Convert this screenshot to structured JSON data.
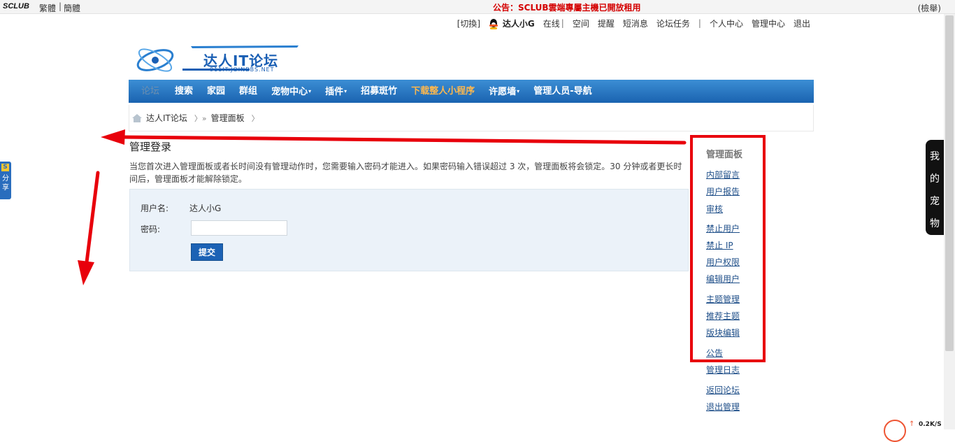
{
  "topbar": {
    "brand": "SCLUB",
    "lang_traditional": "繁體",
    "lang_separator": "|",
    "lang_simplified": "簡體",
    "announcement": "公告：SCLUB雲端專屬主機已開放租用",
    "login": "(檢舉)"
  },
  "userbar": {
    "switch": "[切換]",
    "username": "达人小G",
    "online": "在线",
    "sep1": "|",
    "space": "空间",
    "remind": "提醒",
    "messages": "短消息",
    "tasks": "论坛任务",
    "sep2": "|",
    "profile": "个人中心",
    "admin_center": "管理中心",
    "logout": "退出"
  },
  "logo": {
    "title": "达人IT论坛",
    "subtitle": "911IT.JOINBBS.NET"
  },
  "nav": {
    "items": [
      {
        "label": "论坛",
        "has_caret": false,
        "style": "home"
      },
      {
        "label": "搜索",
        "has_caret": false,
        "style": "normal"
      },
      {
        "label": "家园",
        "has_caret": false,
        "style": "normal"
      },
      {
        "label": "群组",
        "has_caret": false,
        "style": "normal"
      },
      {
        "label": "宠物中心",
        "has_caret": true,
        "style": "normal"
      },
      {
        "label": "插件",
        "has_caret": true,
        "style": "normal"
      },
      {
        "label": "招募斑竹",
        "has_caret": false,
        "style": "normal"
      },
      {
        "label": "下载整人小程序",
        "has_caret": false,
        "style": "highlight"
      },
      {
        "label": "许愿墙",
        "has_caret": true,
        "style": "normal"
      },
      {
        "label": "管理人员-导航",
        "has_caret": false,
        "style": "normal"
      }
    ]
  },
  "breadcrumb": {
    "home": "达人IT论坛",
    "sep1": "〉»",
    "current": "管理面板",
    "sep2": "〉"
  },
  "main": {
    "title": "管理登录",
    "notice": "当您首次进入管理面板或者长时间没有管理动作时，您需要输入密码才能进入。如果密码输入错误超过 3 次，管理面板将会锁定。30 分钟或者更长时间后，管理面板才能解除锁定。",
    "username_label": "用户名:",
    "username_value": "达人小G",
    "password_label": "密码:",
    "password_value": "",
    "submit": "提交"
  },
  "side_panel": {
    "title": "管理面板",
    "links": [
      "内部留言",
      "用户报告",
      "审核",
      "禁止用户",
      "禁止 IP",
      "用户权限",
      "编辑用户",
      "主题管理",
      "推荐主题",
      "版块编辑",
      "公告",
      "管理日志",
      "返回论坛",
      "退出管理"
    ]
  },
  "share_tab": {
    "badge": "S",
    "text": "分享"
  },
  "pet_tab": {
    "text": "我的宠物"
  },
  "speed_widget": {
    "value": "0.2K/S",
    "arrow": "↑"
  },
  "colors": {
    "nav_top": "#3c8ed4",
    "nav_bottom": "#1a63b0",
    "annotation_red": "#e8000b",
    "announcement_red": "#d40000",
    "submit_blue": "#1c62b5"
  }
}
